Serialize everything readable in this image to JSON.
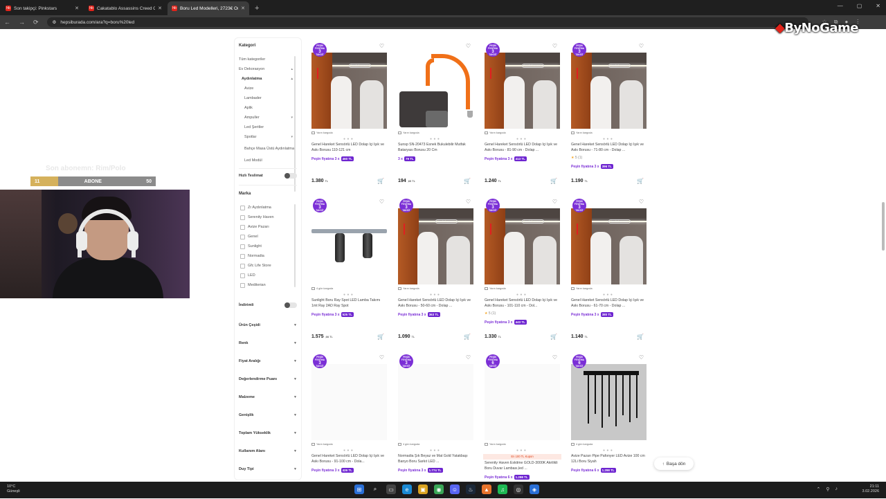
{
  "browser": {
    "tabs": [
      {
        "title": "Son takipçi: Pinkstars",
        "active": false
      },
      {
        "title": "Cakatablo Assassins Creed Od...",
        "active": false
      },
      {
        "title": "Boru Led Modelleri, 2723€ Ortal",
        "active": true
      }
    ],
    "url": "hepsiburada.com/ara?q=boru%20led",
    "favicon_text": "hb"
  },
  "overlay": {
    "watermark": "ByNoGame",
    "goal": {
      "current": "11",
      "label": "ABONE",
      "target": "50",
      "progress": 0.22
    },
    "ghost_text": "Son abonemn: Rim/Polo"
  },
  "sidebar": {
    "kategori_title": "Kategori",
    "categories": [
      {
        "label": "Tüm kategoriler",
        "level": 0
      },
      {
        "label": "Ev Dekorasyon",
        "level": 0,
        "chev": "▴"
      },
      {
        "label": "Aydınlatma",
        "level": 1,
        "chev": "▴",
        "bold": true
      },
      {
        "label": "Avize",
        "level": 2
      },
      {
        "label": "Lambader",
        "level": 2
      },
      {
        "label": "Aplik",
        "level": 2
      },
      {
        "label": "Ampuller",
        "level": 2,
        "chev": "▾"
      },
      {
        "label": "Led Şeritler",
        "level": 2
      },
      {
        "label": "Spotlar",
        "level": 2,
        "chev": "▾"
      },
      {
        "label": "Bahçe Masa Üstü Aydınlatma",
        "level": 2,
        "wrap": true
      },
      {
        "label": "Led Modül",
        "level": 2
      }
    ],
    "hizli_teslimat": "Hızlı Teslimat",
    "marka_title": "Marka",
    "brands": [
      "Zr Aydınlatma",
      "Serenity Haven",
      "Avize Pazarı",
      "Genel",
      "Sunlight",
      "Normadia",
      "Gfc Life Store",
      "LED",
      "Mediterian"
    ],
    "indirimli": "İndirimli",
    "filters": [
      "Ürün Çeşidi",
      "Renk",
      "Fiyat Aralığı",
      "Değerlendirme Puanı",
      "Malzeme",
      "Genişlik",
      "Toplam Yükseklik",
      "Kullanım Alanı",
      "Duy Tipi"
    ]
  },
  "badge": {
    "top": "PEŞİN FİYATINA",
    "num": "3",
    "bottom": "TAKSİT"
  },
  "products": [
    {
      "name": "Genel Hareket Sensörlü LED Dolap İçi Işık ve Askı Borusu 110-121 cm",
      "inst_label": "Peşin fiyatına 3 x",
      "inst_amount": "460 TL",
      "price": "1.380",
      "price_unit": "TL",
      "cargo": "Yarın kargoda",
      "image": "closet",
      "badge": "3"
    },
    {
      "name": "Sunsp SN-20473 Esnek Bukulebilir Mutfak Bataryası Borusu 20 Cm",
      "inst_label": "3 x",
      "inst_amount": "79 TL",
      "price": "194",
      "price_unit": ",65 TL",
      "cargo": "Yarın kargoda",
      "image": "faucet",
      "badge": ""
    },
    {
      "name": "Genel Hareket Sensörlü LED Dolap İçi Işık ve Askı Borusu - 81-90 cm - Dolap ...",
      "inst_label": "Peşin fiyatına 3 x",
      "inst_amount": "413 TL",
      "price": "1.240",
      "price_unit": "TL",
      "cargo": "Yarın kargoda",
      "image": "closet",
      "badge": "3"
    },
    {
      "name": "Genel Hareket Sensörlü LED Dolap İçi Işık ve Askı Borusu - 71-80 cm - Dolap ...",
      "rating": "5",
      "rating_count": "(1)",
      "inst_label": "Peşin fiyatına 3 x",
      "inst_amount": "396 TL",
      "price": "1.190",
      "price_unit": "TL",
      "cargo": "Yarın kargoda",
      "image": "closet",
      "badge": "3"
    },
    {
      "name": "Sunlight Boru Ray Spot LED Lamba Takımı 1mt Ray 2AD Ray Spot",
      "inst_label": "Peşin fiyatına 3 x",
      "inst_amount": "525 TL",
      "price": "1.575",
      "price_unit": ",66 TL",
      "cargo": "4 gün kargoda",
      "image": "track",
      "badge": "3"
    },
    {
      "name": "Genel Hareket Sensörlü LED Dolap İçi Işık ve Askı Borusu - 50-60 cm - Dolap ...",
      "inst_label": "Peşin fiyatına 3 x",
      "inst_amount": "363 TL",
      "price": "1.090",
      "price_unit": "TL",
      "cargo": "Yarın kargoda",
      "image": "closet",
      "badge": "3"
    },
    {
      "name": "Genel Hareket Sensörlü LED Dolap İçi Işık ve Askı Borusu - 101-110 cm - Dol...",
      "rating": "5",
      "rating_count": "(1)",
      "inst_label": "Peşin fiyatına 3 x",
      "inst_amount": "443 TL",
      "price": "1.330",
      "price_unit": "TL",
      "cargo": "Yarın kargoda",
      "image": "closet",
      "badge": "3"
    },
    {
      "name": "Genel Hareket Sensörlü LED Dolap İçi Işık ve Askı Borusu - 61-70 cm - Dolap ...",
      "inst_label": "Peşin fiyatına 3 x",
      "inst_amount": "380 TL",
      "price": "1.140",
      "price_unit": "TL",
      "cargo": "Yarın kargoda",
      "image": "closet",
      "badge": "3"
    },
    {
      "name": "Genel Hareket Sensörlü LED Dolap İçi Işık ve Askı Borusu - 91-100 cm - Dola...",
      "inst_label": "Peşin fiyatına 3 x",
      "inst_amount": "426 TL",
      "price": "",
      "price_unit": "",
      "cargo": "Yarın kargoda",
      "image": "blank",
      "badge": "3"
    },
    {
      "name": "Normadia Şık Beyaz ve Mat Gold Yatakbaşı Banyo Boru Sarkıt LED ...",
      "inst_label": "Peşin fiyatına 3 x",
      "inst_amount": "1.774 TL",
      "price": "",
      "price_unit": "",
      "cargo": "4 gün kargoda",
      "image": "blank",
      "badge": "3"
    },
    {
      "name": "Serenity Haven Eskitme GOLD-3000K Akrilikli Boru Duvar Lambası,led ...",
      "promo": "En 100 TL Kupon",
      "inst_label": "Peşin fiyatına 6 x",
      "inst_amount": "1.298 TL",
      "price": "",
      "price_unit": "",
      "cargo": "Yarın kargoda",
      "image": "blank",
      "badge": "6"
    },
    {
      "name": "Avize Pazarı Pipe Pafonyer LED Avize 100 cm 12Li Boru Siyah",
      "inst_label": "Peşin fiyatına 6 x",
      "inst_amount": "1.298 TL",
      "price": "",
      "price_unit": "",
      "cargo": "4 gün kargoda",
      "image": "pendant",
      "badge": "6"
    }
  ],
  "basa_don": "Başa dön",
  "taskbar": {
    "weather_temp": "10°C",
    "weather_desc": "Güneşli",
    "time": "21:11",
    "date": "3.02.2026"
  }
}
